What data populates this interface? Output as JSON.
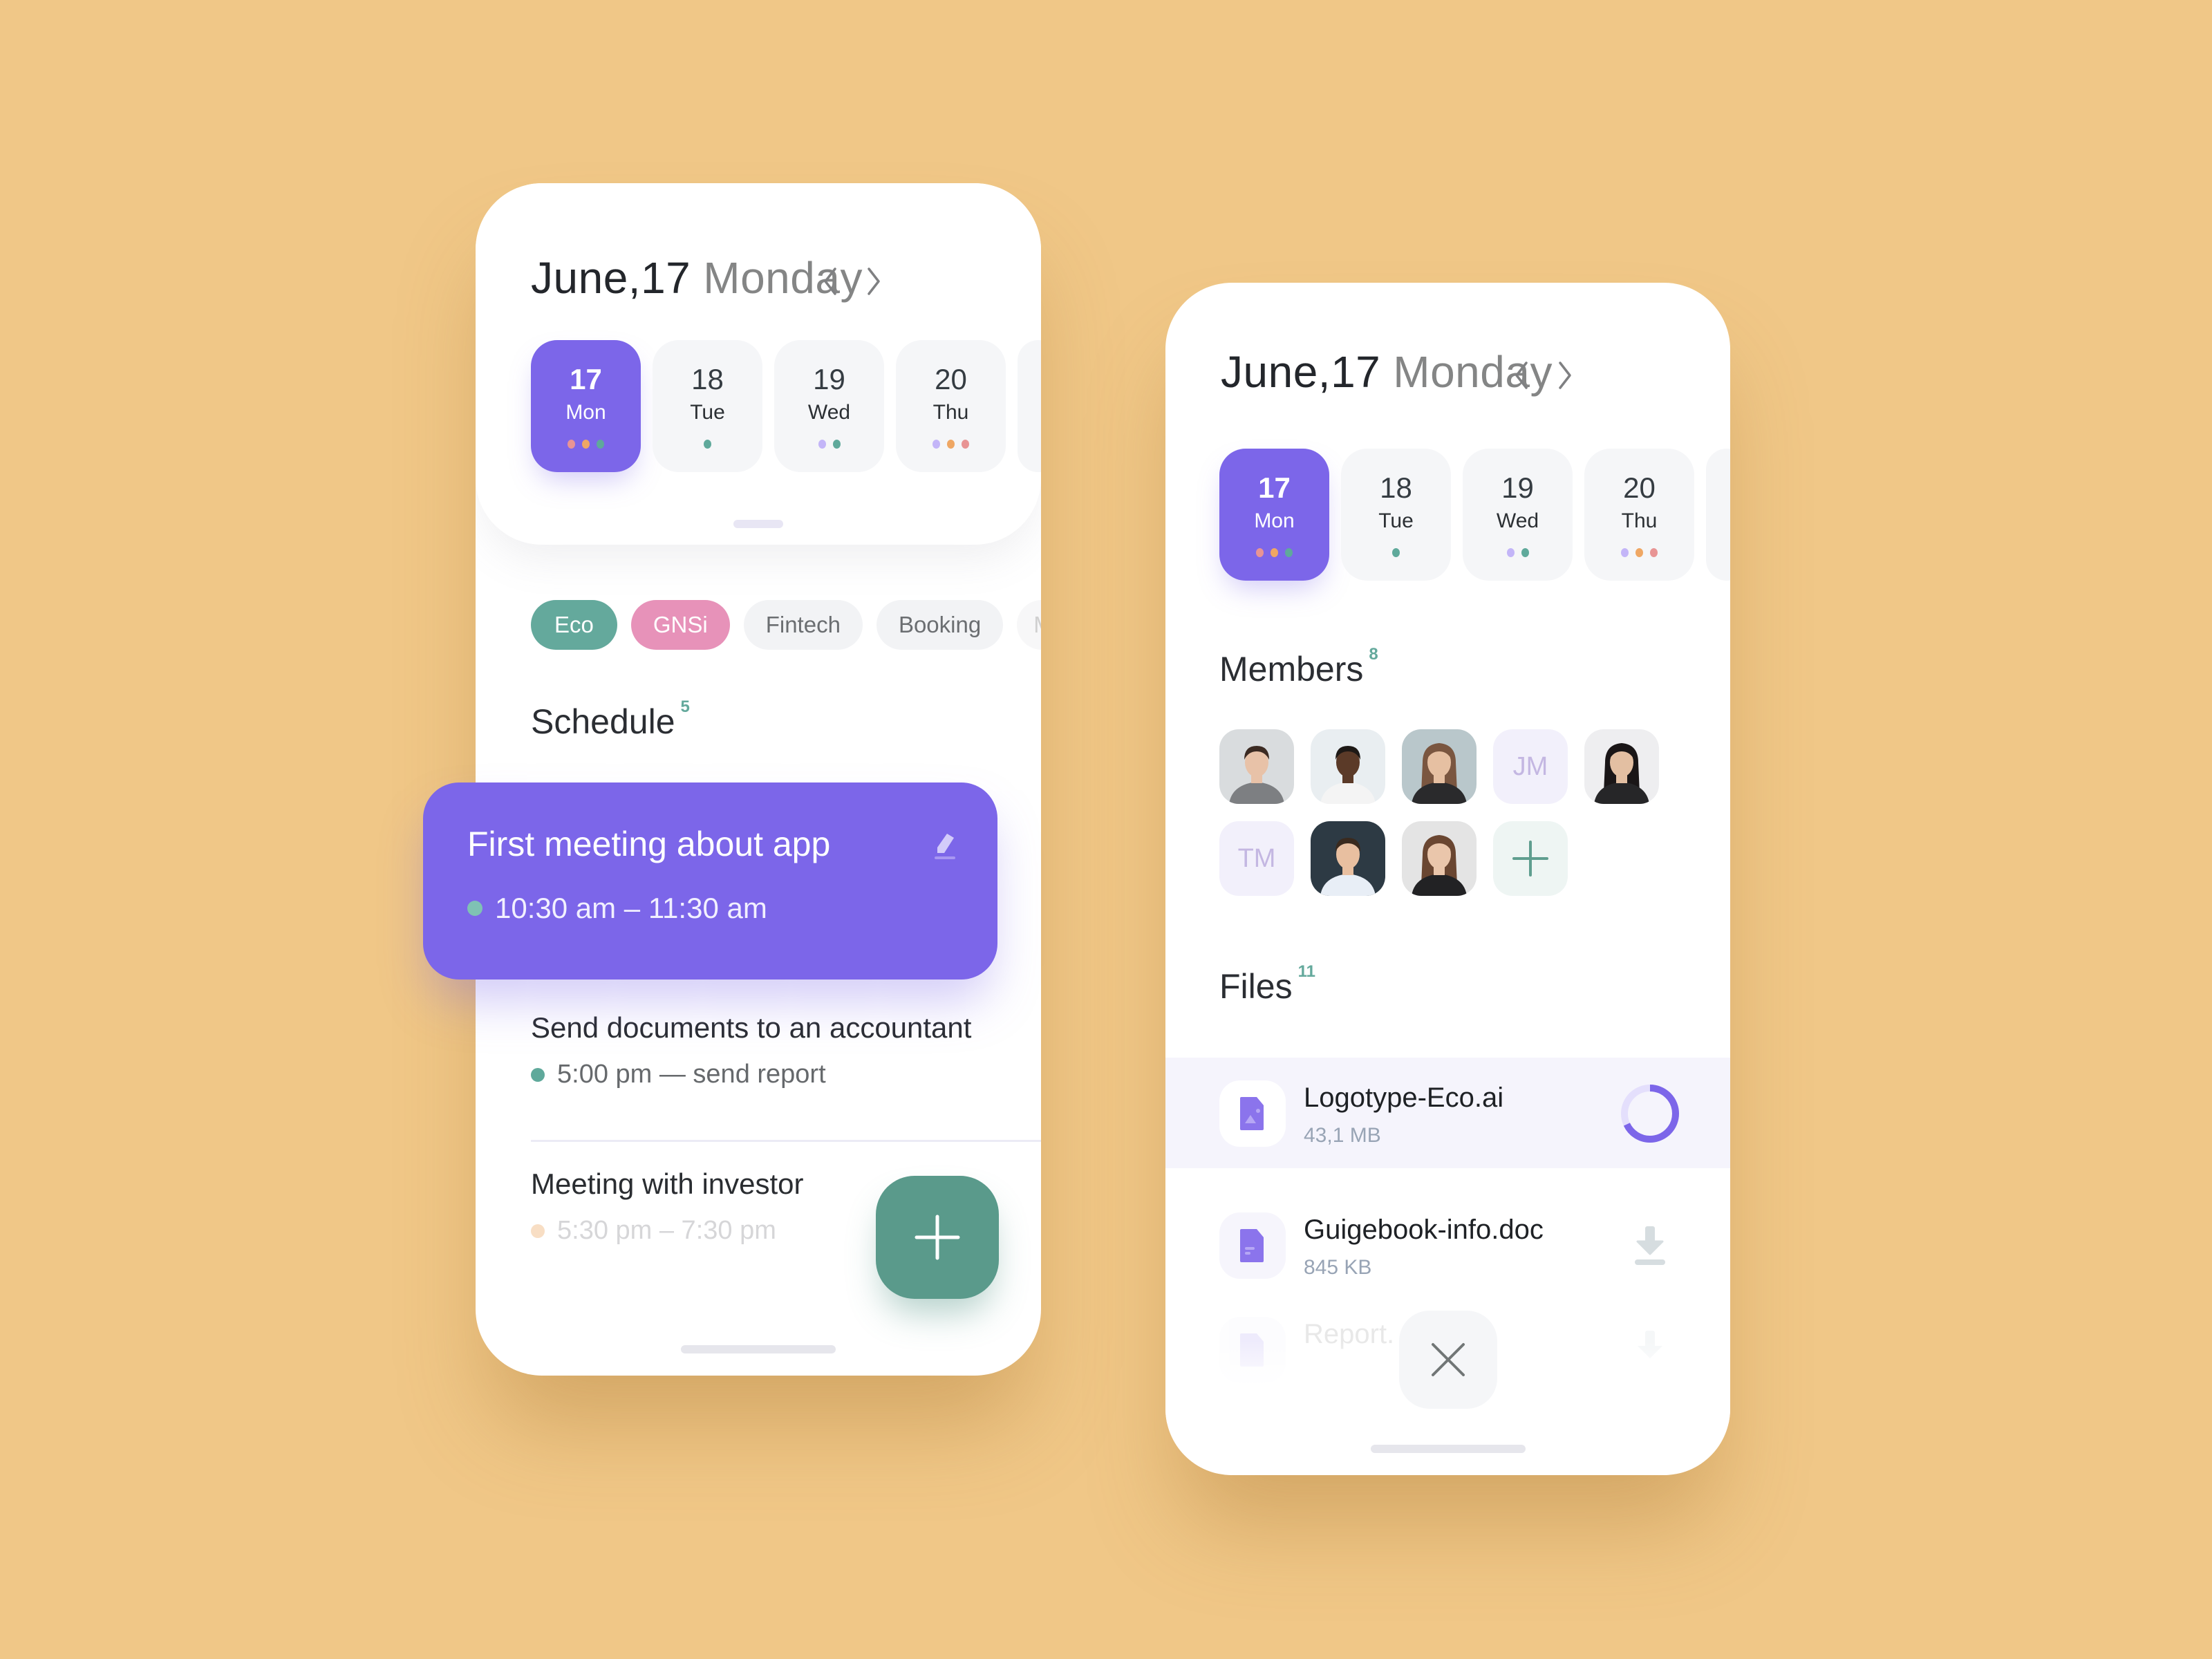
{
  "colors": {
    "background": "#F0C787",
    "accent_purple": "#7C66E9",
    "accent_teal": "#5A9A8B",
    "chip_eco": "#64A99C",
    "chip_gnsi": "#E792B9",
    "dot_pink": "#E89494",
    "dot_orange": "#EFA764",
    "dot_teal": "#5FA99B",
    "dot_lavender": "#C3B5F8",
    "dot_peach": "#F8DEC4"
  },
  "left_phone": {
    "header": {
      "date": "June,17",
      "weekday": "Monday",
      "prev_icon": "chevron-left-icon",
      "next_icon": "chevron-right-icon"
    },
    "days": [
      {
        "num": "17",
        "dow": "Mon",
        "active": true,
        "dots": [
          "dot_pink",
          "dot_orange",
          "dot_teal"
        ]
      },
      {
        "num": "18",
        "dow": "Tue",
        "active": false,
        "dots": [
          "dot_teal"
        ]
      },
      {
        "num": "19",
        "dow": "Wed",
        "active": false,
        "dots": [
          "dot_lavender",
          "dot_teal"
        ]
      },
      {
        "num": "20",
        "dow": "Thu",
        "active": false,
        "dots": [
          "dot_lavender",
          "dot_orange",
          "dot_pink"
        ]
      }
    ],
    "chips": [
      {
        "label": "Eco",
        "active": true
      },
      {
        "label": "GNSi",
        "active": true
      },
      {
        "label": "Fintech",
        "active": false
      },
      {
        "label": "Booking",
        "active": false
      },
      {
        "label": "M",
        "active": false
      }
    ],
    "schedule": {
      "title": "Schedule",
      "count": "5",
      "highlight": {
        "title": "First meeting about app",
        "time": "10:30 am – 11:30 am",
        "edit_icon": "pencil-icon"
      },
      "items": [
        {
          "title": "Send documents to an accountant",
          "subtitle": "5:00 pm — send report"
        },
        {
          "title": "Meeting with investor",
          "subtitle": "5:30 pm – 7:30 pm"
        }
      ]
    },
    "fab_icon": "plus-icon"
  },
  "right_phone": {
    "header": {
      "date": "June,17",
      "weekday": "Monday"
    },
    "days": [
      {
        "num": "17",
        "dow": "Mon",
        "active": true,
        "dots": [
          "dot_pink",
          "dot_orange",
          "dot_teal"
        ]
      },
      {
        "num": "18",
        "dow": "Tue",
        "active": false,
        "dots": [
          "dot_teal"
        ]
      },
      {
        "num": "19",
        "dow": "Wed",
        "active": false,
        "dots": [
          "dot_lavender",
          "dot_teal"
        ]
      },
      {
        "num": "20",
        "dow": "Thu",
        "active": false,
        "dots": [
          "dot_lavender",
          "dot_orange",
          "dot_pink"
        ]
      }
    ],
    "members": {
      "title": "Members",
      "count": "8",
      "list": [
        {
          "type": "photo",
          "desc": "woman-short-dark-hair"
        },
        {
          "type": "photo",
          "desc": "man-white-shirt"
        },
        {
          "type": "photo",
          "desc": "woman-long-brown-hair"
        },
        {
          "type": "initials",
          "initials": "JM"
        },
        {
          "type": "photo",
          "desc": "woman-glasses"
        },
        {
          "type": "initials",
          "initials": "TM"
        },
        {
          "type": "photo",
          "desc": "man-tie-curly-hair"
        },
        {
          "type": "photo",
          "desc": "woman-bob-hair"
        },
        {
          "type": "add"
        }
      ]
    },
    "files": {
      "title": "Files",
      "count": "11",
      "list": [
        {
          "name": "Logotype-Eco.ai",
          "size": "43,1 MB",
          "icon": "image-file-icon",
          "action": "progress",
          "progress": 0.68
        },
        {
          "name": "Guigebook-info.doc",
          "size": "845 KB",
          "icon": "document-file-icon",
          "action": "download"
        },
        {
          "name": "Report.",
          "size": "",
          "icon": "document-file-icon",
          "action": "download"
        }
      ]
    },
    "close_icon": "close-icon"
  }
}
